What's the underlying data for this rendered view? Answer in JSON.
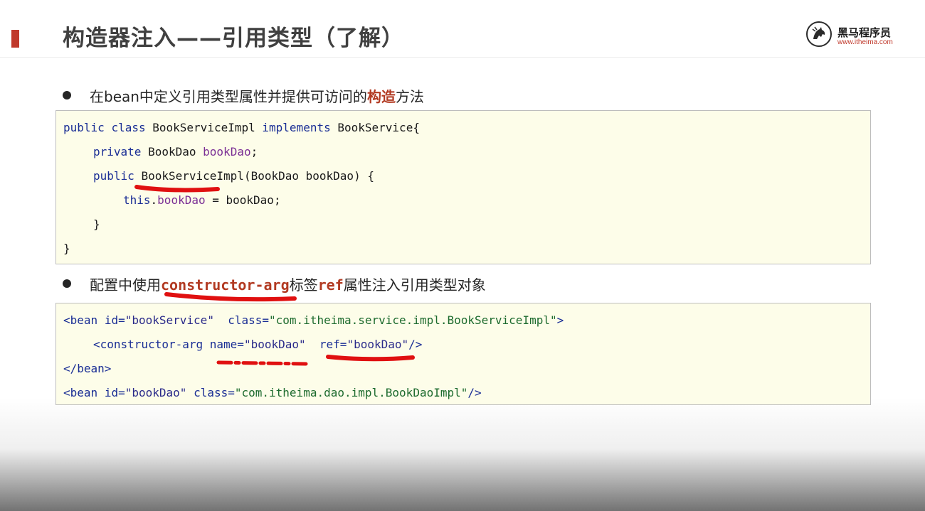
{
  "header": {
    "title": "构造器注入——引用类型（了解）",
    "logo": {
      "name": "黑马程序员",
      "url": "www.itheima.com",
      "icon": "horse-logo-icon"
    }
  },
  "bullets": [
    {
      "pre": "在bean中定义引用类型属性并提供可访问的",
      "highlight": "构造",
      "post": "方法"
    },
    {
      "pre": "配置中使用",
      "highlight": "constructor-arg",
      "mid": "标签",
      "highlight2": "ref",
      "post": "属性注入引用类型对象"
    }
  ],
  "java_code": {
    "l1_kw1": "public",
    "l1_kw2": "class",
    "l1_name": "BookServiceImpl",
    "l1_kw3": "implements",
    "l1_iface": "BookService{",
    "l2_kw": "private",
    "l2_type": "BookDao",
    "l2_field": "bookDao",
    "l2_end": ";",
    "l3_kw": "public",
    "l3_name": "BookServiceImpl",
    "l3_rest": "(BookDao bookDao) {",
    "l4_kw": "this",
    "l4_dot": ".",
    "l4_field": "bookDao",
    "l4_rest": " = bookDao;",
    "l5": "}",
    "l6": "}"
  },
  "xml_code": {
    "l1_open": "<bean",
    "l1_id_attr": "id=",
    "l1_id_val": "\"bookService\"",
    "l1_class_attr": "class=",
    "l1_class_val": "\"com.itheima.service.impl.BookServiceImpl\"",
    "l1_close": ">",
    "l2_open": "<constructor-arg",
    "l2_name_attr": "name=",
    "l2_name_val": "\"bookDao\"",
    "l2_ref_attr": "ref=",
    "l2_ref_val": "\"bookDao\"",
    "l2_close": "/>",
    "l3": "</bean>",
    "l4_open": "<bean",
    "l4_id_attr": "id=",
    "l4_id_val": "\"bookDao\"",
    "l4_class_attr": "class=",
    "l4_class_val": "\"com.itheima.dao.impl.BookDaoImpl\"",
    "l4_close": "/>"
  },
  "colors": {
    "accent": "#c0392b",
    "highlight": "#b23a22",
    "code_bg": "#fdfde9",
    "scribble": "#e01010"
  }
}
